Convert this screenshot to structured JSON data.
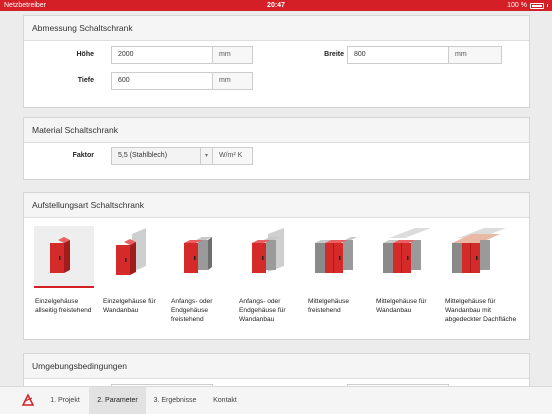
{
  "statusbar": {
    "carrier": "Netzbetreiber",
    "time": "20:47",
    "battery": "100 %"
  },
  "dimensions": {
    "title": "Abmessung Schaltschrank",
    "height": {
      "label": "Höhe",
      "value": "2000",
      "unit": "mm"
    },
    "width": {
      "label": "Breite",
      "value": "800",
      "unit": "mm"
    },
    "depth": {
      "label": "Tiefe",
      "value": "600",
      "unit": "mm"
    }
  },
  "material": {
    "title": "Material Schaltschrank",
    "factor": {
      "label": "Faktor",
      "value": "5,5 (Stahlblech)",
      "unit": "W/m² K"
    }
  },
  "installation": {
    "title": "Aufstellungsart Schaltschrank",
    "options": [
      {
        "label": "Einzelgehäuse allseitig freistehend",
        "icon": "single-cabinet-icon",
        "selected": true
      },
      {
        "label": "Einzelgehäuse für Wandanbau",
        "icon": "single-cabinet-wall-icon"
      },
      {
        "label": "Anfangs- oder Endgehäuse freistehend",
        "icon": "end-cabinet-icon"
      },
      {
        "label": "Anfangs- oder Endgehäuse für Wandanbau",
        "icon": "end-cabinet-wall-icon"
      },
      {
        "label": "Mittelgehäuse freistehend",
        "icon": "middle-cabinet-icon"
      },
      {
        "label": "Mittelgehäuse für Wandanbau",
        "icon": "middle-cabinet-wall-icon"
      },
      {
        "label": "Mittelgehäuse für Wandanbau mit abgedeckter Dachfläche",
        "icon": "middle-cabinet-wall-roof-icon"
      }
    ]
  },
  "environment": {
    "title": "Umgebungsbedingungen"
  },
  "tabs": [
    {
      "label": "1. Projekt"
    },
    {
      "label": "2. Parameter",
      "active": true
    },
    {
      "label": "3. Ergebnisse"
    },
    {
      "label": "Kontakt"
    }
  ],
  "colors": {
    "accent": "#d41f26",
    "cabinet_red": "#d42a2a",
    "cabinet_grey": "#8a8a8a"
  }
}
